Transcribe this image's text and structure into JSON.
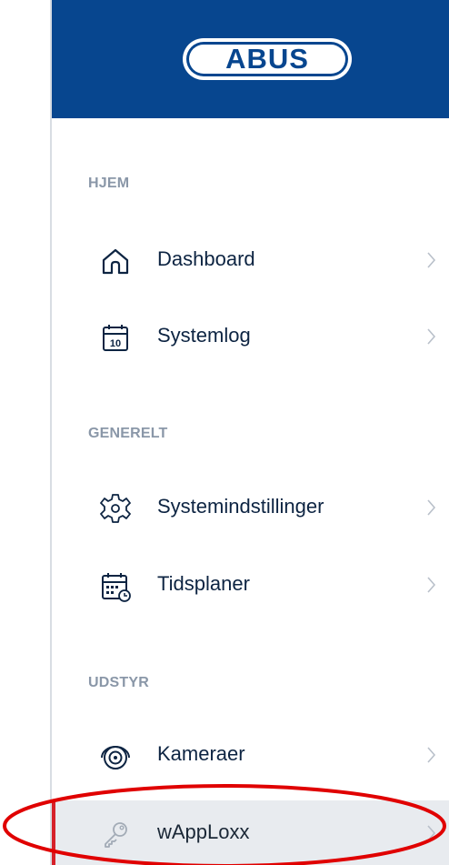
{
  "brand": {
    "logo_text": "ABUS",
    "header_color": "#07468f"
  },
  "sections": [
    {
      "title": "HJEM",
      "items": [
        {
          "label": "Dashboard",
          "icon": "home-icon"
        },
        {
          "label": "Systemlog",
          "icon": "calendar-10-icon",
          "icon_text": "10"
        }
      ]
    },
    {
      "title": "GENERELT",
      "items": [
        {
          "label": "Systemindstillinger",
          "icon": "gear-icon"
        },
        {
          "label": "Tidsplaner",
          "icon": "calendar-clock-icon"
        }
      ]
    },
    {
      "title": "UDSTYR",
      "items": [
        {
          "label": "Kameraer",
          "icon": "camera-icon"
        },
        {
          "label": "wAppLoxx",
          "icon": "key-icon",
          "active": true
        }
      ]
    }
  ],
  "colors": {
    "accent": "#d6212a",
    "section_title": "#8a97a8",
    "active_bg": "#e8ebef",
    "annotation": "#e00000"
  }
}
